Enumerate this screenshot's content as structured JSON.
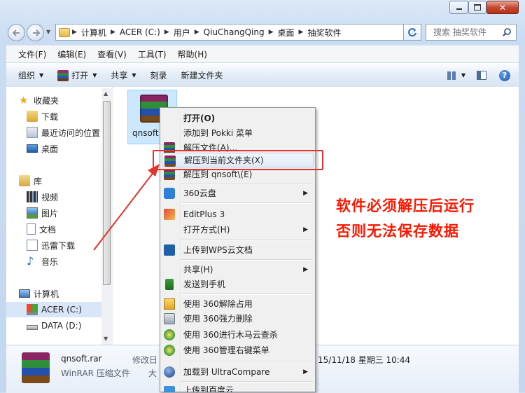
{
  "address": {
    "crumbs": [
      "计算机",
      "ACER (C:)",
      "用户",
      "QiuChangQing",
      "桌面",
      "抽奖软件"
    ]
  },
  "search": {
    "placeholder": "搜索 抽奖软件"
  },
  "menubar": [
    "文件(F)",
    "编辑(E)",
    "查看(V)",
    "工具(T)",
    "帮助(H)"
  ],
  "toolbar": {
    "organize": "组织",
    "open": "打开",
    "share": "共享",
    "burn": "刻录",
    "new_folder": "新建文件夹"
  },
  "nav": {
    "favorites": "收藏夹",
    "downloads": "下载",
    "recent": "最近访问的位置",
    "desktop": "桌面",
    "libraries": "库",
    "videos": "视频",
    "pictures": "图片",
    "documents": "文档",
    "thunder": "迅雷下载",
    "music": "音乐",
    "computer": "计算机",
    "drive_c": "ACER (C:)",
    "drive_d": "DATA (D:)"
  },
  "file": {
    "name": "qnsoft"
  },
  "details": {
    "name": "qnsoft.rar",
    "type": "WinRAR 压缩文件",
    "modified_label": "修改日",
    "size_label": "大",
    "date": "15/11/18 星期三 10:44"
  },
  "context_menu": {
    "open": "打开(O)",
    "add_pokki": "添加到 Pokki 菜单",
    "extract_files": "解压文件(A)...",
    "extract_here": "解压到当前文件夹(X)",
    "extract_to": "解压到 qnsoft\\(E)",
    "cloud360": "360云盘",
    "editplus": "EditPlus 3",
    "open_with": "打开方式(H)",
    "wps_upload": "上传到WPS云文档",
    "share": "共享(H)",
    "send_phone": "发送到手机",
    "unlock360": "使用 360解除占用",
    "force_delete": "使用 360强力删除",
    "trojan_scan": "使用 360进行木马云查杀",
    "menu_mgr": "使用 360管理右键菜单",
    "ultracompare": "加载到 UltraCompare",
    "upload_cut": "上传到百度云"
  },
  "annotation": {
    "line1": "软件必须解压后运行",
    "line2": "否则无法保存数据"
  },
  "colors": {
    "annotation": "#ff1600",
    "highlight_box": "#e8312a",
    "arrow": "#e8312a"
  }
}
